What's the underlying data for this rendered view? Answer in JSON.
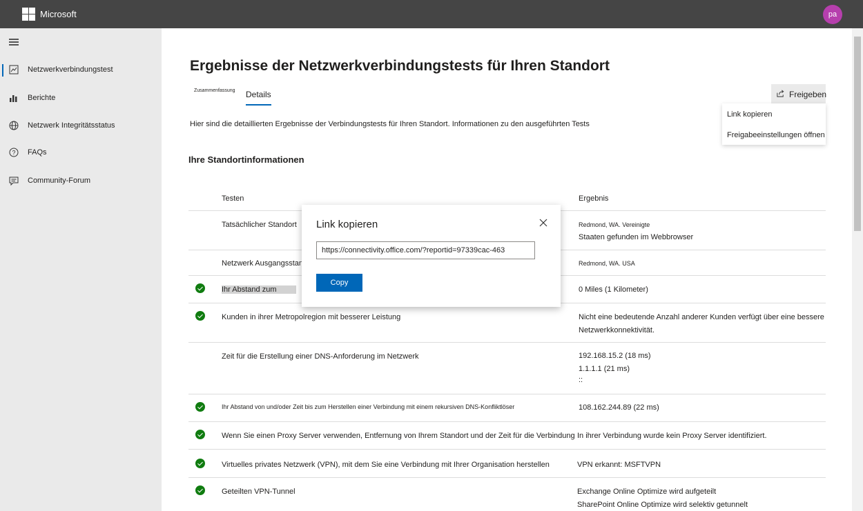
{
  "header": {
    "brand": "Microsoft",
    "avatar_initials": "pa"
  },
  "sidebar": {
    "items": [
      {
        "label": "Netzwerkverbindungstest",
        "icon": "report-chart-icon",
        "active": true
      },
      {
        "label": "Berichte",
        "icon": "bar-chart-icon",
        "active": false
      },
      {
        "label": "Netzwerk Integritätsstatus",
        "icon": "globe-icon",
        "active": false
      },
      {
        "label": "FAQs",
        "icon": "question-icon",
        "active": false
      },
      {
        "label": "Community-Forum",
        "icon": "comment-icon",
        "active": false
      }
    ]
  },
  "main": {
    "title": "Ergebnisse der Netzwerkverbindungstests für Ihren Standort",
    "tabs": [
      {
        "label": "Zusammenfassung"
      },
      {
        "label": "Details",
        "selected": true
      }
    ],
    "share": {
      "label": "Freigeben",
      "menu": [
        "Link kopieren",
        "Freigabeeinstellungen öffnen"
      ]
    },
    "intro": "Hier sind die detaillierten Ergebnisse der Verbindungstests für Ihren Standort. Informationen zu den ausgeführten Tests",
    "section_title": "Ihre Standortinformationen",
    "table": {
      "headers": [
        "Testen",
        "Ergebnis"
      ],
      "rows": [
        {
          "check": false,
          "test": "Tatsächlicher Standort",
          "result": [
            "Redmond, WA. Vereinigte",
            "Staaten gefunden im Webbrowser"
          ]
        },
        {
          "check": false,
          "test": "Netzwerk Ausgangsstandort",
          "result": [
            "Redmond, WA. USA"
          ]
        },
        {
          "check": true,
          "test": "Ihr Abstand zum",
          "result": [
            "0 Miles (1 Kilometer)"
          ]
        },
        {
          "check": true,
          "test": "Kunden in ihrer Metropolregion mit besserer Leistung",
          "result": [
            "Nicht eine bedeutende Anzahl anderer Kunden verfügt über eine bessere",
            "Netzwerkkonnektivität."
          ]
        },
        {
          "check": false,
          "test": "Zeit für die Erstellung einer DNS-Anforderung im Netzwerk",
          "result": [
            "192.168.15.2 (18 ms)",
            "1.1.1.1 (21 ms)",
            "::"
          ]
        },
        {
          "check": true,
          "test": "Ihr Abstand von und/oder Zeit bis zum Herstellen einer Verbindung mit einem rekursiven DNS-Konfliktlöser",
          "result": [
            "108.162.244.89 (22 ms)"
          ]
        },
        {
          "check": true,
          "test": "Wenn Sie einen Proxy Server verwenden, Entfernung von Ihrem Standort und der Zeit für die Verbindung",
          "result": [
            "In ihrer Verbindung wurde kein Proxy Server identifiziert."
          ]
        },
        {
          "check": true,
          "test": "Virtuelles privates Netzwerk (VPN), mit dem Sie eine Verbindung mit Ihrer Organisation herstellen",
          "result": [
            "VPN erkannt: MSFTVPN"
          ]
        },
        {
          "check": true,
          "test": "Geteilten VPN-Tunnel",
          "result": [
            "Exchange Online Optimize wird aufgeteilt",
            "SharePoint Online Optimize wird selektiv getunnelt"
          ]
        }
      ]
    }
  },
  "dialog": {
    "title": "Link kopieren",
    "url_value": "https://connectivity.office.com/?reportid=97339cac-463",
    "copy_label": "Copy"
  },
  "colors": {
    "accent": "#0067b8",
    "success": "#107c10",
    "header_bg": "#454545",
    "sidebar_bg": "#eaeaea",
    "avatar": "#b63fad"
  }
}
